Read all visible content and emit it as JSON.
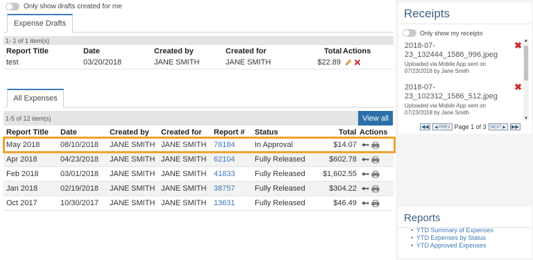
{
  "drafts": {
    "toggle_label": "Only show drafts created for me",
    "tab_label": "Expense Drafts",
    "item_count": "1- 1 of 1 item(s)",
    "columns": [
      "Report Title",
      "Date",
      "Created by",
      "Created for",
      "Total",
      "Actions"
    ],
    "rows": [
      {
        "title": "test",
        "date": "03/20/2018",
        "created_by": "JANE SMITH",
        "created_for": "JANE SMITH",
        "total": "$22.89"
      }
    ]
  },
  "expenses": {
    "tab_label": "All Expenses",
    "item_count": "1-5 of 12 item(s)",
    "view_all_label": "View all",
    "columns": [
      "Report Title",
      "Date",
      "Created by",
      "Created for",
      "Report #",
      "Status",
      "Total",
      "Actions"
    ],
    "rows": [
      {
        "title": "May 2018",
        "date": "08/10/2018",
        "created_by": "JANE SMITH",
        "created_for": "JANE SMITH",
        "report_no": "78184",
        "status": "In Approval",
        "total": "$14.07"
      },
      {
        "title": "Apr 2018",
        "date": "04/23/2018",
        "created_by": "JANE SMITH",
        "created_for": "JANE SMITH",
        "report_no": "62104",
        "status": "Fully Released",
        "total": "$602.78"
      },
      {
        "title": "Feb 2018",
        "date": "03/01/2018",
        "created_by": "JANE SMITH",
        "created_for": "JANE SMITH",
        "report_no": "41833",
        "status": "Fully Released",
        "total": "$1,602.55"
      },
      {
        "title": "Jan 2018",
        "date": "02/19/2018",
        "created_by": "JANE SMITH",
        "created_for": "JANE SMITH",
        "report_no": "38757",
        "status": "Fully Released",
        "total": "$304.22"
      },
      {
        "title": "Oct 2017",
        "date": "10/30/2017",
        "created_by": "JANE SMITH",
        "created_for": "JANE SMITH",
        "report_no": "13631",
        "status": "Fully Released",
        "total": "$46.49"
      }
    ]
  },
  "receipts": {
    "title": "Receipts",
    "toggle_label": "Only show my receipts",
    "items": [
      {
        "name_line1": "2018-07-",
        "name_line2": "23_132444_1586_996.jpeg",
        "sub_line1": "Uploaded via Mobile App sent on",
        "sub_line2": "07/23/2018 by Jane Smith"
      },
      {
        "name_line1": "2018-07-",
        "name_line2": "23_102312_1586_512.jpeg",
        "sub_line1": "Uploaded via Mobile App sent on",
        "sub_line2": "07/23/2018 by Jane Smith"
      }
    ],
    "pager": {
      "first": "◀◀",
      "prev": "◀ PREV",
      "label": "Page 1 of 3",
      "next": "NEXT ▶",
      "last": "▶▶"
    }
  },
  "reports": {
    "title": "Reports",
    "links": [
      "YTD Summary of Expenses",
      "YTD Expenses by Status",
      "YTD Approved Expenses"
    ]
  },
  "colors": {
    "accent": "#2b6fa9",
    "link": "#3a78b8",
    "highlight": "#f0a22c",
    "delete": "#c8302b"
  }
}
